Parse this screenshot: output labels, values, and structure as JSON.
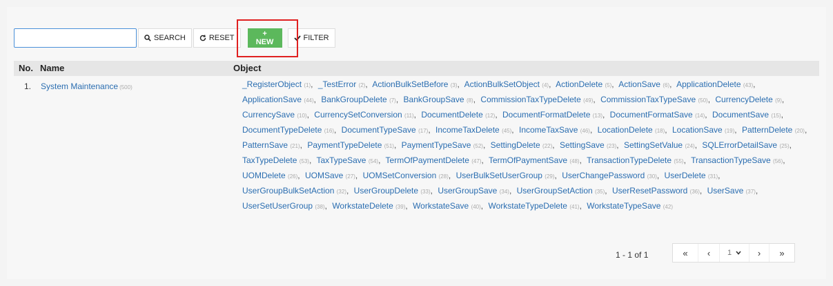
{
  "toolbar": {
    "search_value": "",
    "search_label": "SEARCH",
    "reset_label": "RESET",
    "new_label": "+ NEW",
    "filter_label": "FILTER"
  },
  "table": {
    "col_no": "No.",
    "col_name": "Name",
    "col_object": "Object",
    "row": {
      "no": "1.",
      "name": "System Maintenance",
      "count": "(500)",
      "objects": [
        [
          "_RegisterObject",
          "(1)"
        ],
        [
          "_TestError",
          "(2)"
        ],
        [
          "ActionBulkSetBefore",
          "(3)"
        ],
        [
          "ActionBulkSetObject",
          "(4)"
        ],
        [
          "ActionDelete",
          "(5)"
        ],
        [
          "ActionSave",
          "(6)"
        ],
        [
          "ApplicationDelete",
          "(43)"
        ],
        [
          "ApplicationSave",
          "(44)"
        ],
        [
          "BankGroupDelete",
          "(7)"
        ],
        [
          "BankGroupSave",
          "(8)"
        ],
        [
          "CommissionTaxTypeDelete",
          "(49)"
        ],
        [
          "CommissionTaxTypeSave",
          "(50)"
        ],
        [
          "CurrencyDelete",
          "(9)"
        ],
        [
          "CurrencySave",
          "(10)"
        ],
        [
          "CurrencySetConversion",
          "(11)"
        ],
        [
          "DocumentDelete",
          "(12)"
        ],
        [
          "DocumentFormatDelete",
          "(13)"
        ],
        [
          "DocumentFormatSave",
          "(14)"
        ],
        [
          "DocumentSave",
          "(15)"
        ],
        [
          "DocumentTypeDelete",
          "(16)"
        ],
        [
          "DocumentTypeSave",
          "(17)"
        ],
        [
          "IncomeTaxDelete",
          "(45)"
        ],
        [
          "IncomeTaxSave",
          "(46)"
        ],
        [
          "LocationDelete",
          "(18)"
        ],
        [
          "LocationSave",
          "(19)"
        ],
        [
          "PatternDelete",
          "(20)"
        ],
        [
          "PatternSave",
          "(21)"
        ],
        [
          "PaymentTypeDelete",
          "(51)"
        ],
        [
          "PaymentTypeSave",
          "(52)"
        ],
        [
          "SettingDelete",
          "(22)"
        ],
        [
          "SettingSave",
          "(23)"
        ],
        [
          "SettingSetValue",
          "(24)"
        ],
        [
          "SQLErrorDetailSave",
          "(25)"
        ],
        [
          "TaxTypeDelete",
          "(53)"
        ],
        [
          "TaxTypeSave",
          "(54)"
        ],
        [
          "TermOfPaymentDelete",
          "(47)"
        ],
        [
          "TermOfPaymentSave",
          "(48)"
        ],
        [
          "TransactionTypeDelete",
          "(55)"
        ],
        [
          "TransactionTypeSave",
          "(56)"
        ],
        [
          "UOMDelete",
          "(26)"
        ],
        [
          "UOMSave",
          "(27)"
        ],
        [
          "UOMSetConversion",
          "(28)"
        ],
        [
          "UserBulkSetUserGroup",
          "(29)"
        ],
        [
          "UserChangePassword",
          "(30)"
        ],
        [
          "UserDelete",
          "(31)"
        ],
        [
          "UserGroupBulkSetAction",
          "(32)"
        ],
        [
          "UserGroupDelete",
          "(33)"
        ],
        [
          "UserGroupSave",
          "(34)"
        ],
        [
          "UserGroupSetAction",
          "(35)"
        ],
        [
          "UserResetPassword",
          "(36)"
        ],
        [
          "UserSave",
          "(37)"
        ],
        [
          "UserSetUserGroup",
          "(38)"
        ],
        [
          "WorkstateDelete",
          "(39)"
        ],
        [
          "WorkstateSave",
          "(40)"
        ],
        [
          "WorkstateTypeDelete",
          "(41)"
        ],
        [
          "WorkstateTypeSave",
          "(42)"
        ]
      ]
    }
  },
  "pager": {
    "info": "1 - 1 of 1",
    "first": "«",
    "prev": "‹",
    "page": "1",
    "next": "›",
    "last": "»"
  },
  "colors": {
    "accent": "#5cb85c",
    "link": "#2a6db0",
    "highlight": "#e02020"
  }
}
